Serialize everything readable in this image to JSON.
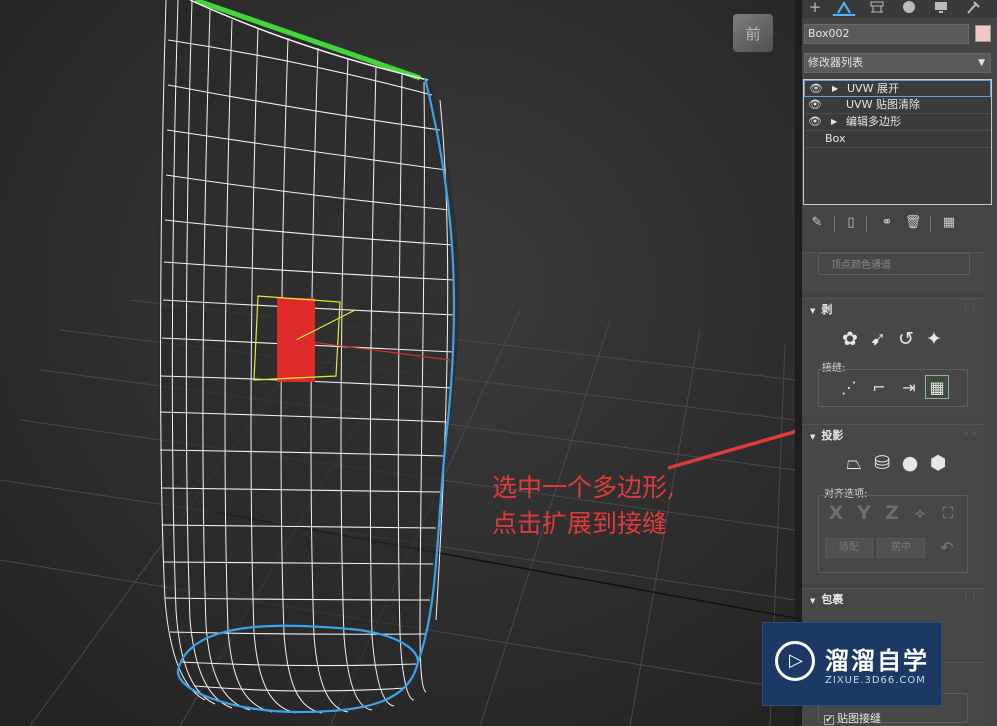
{
  "viewport": {
    "viewcube_label": "前",
    "annotation_lines": [
      "选中一个多边形,",
      "点击扩展到接缝"
    ],
    "colors": {
      "wireframe": "#f2f2f2",
      "seam": "#3aa2e8",
      "selection": "#e8e83a",
      "selected_poly": "#e02b2b",
      "edge_highlight": "#43d63a",
      "arrow": "#e03a3a"
    }
  },
  "command_panel": {
    "tabs": [
      "+",
      "modify-icon",
      "hierarchy-icon",
      "motion-icon",
      "display-icon",
      "utilities-icon"
    ],
    "object_name": "Box002",
    "object_color": "#f4c6c6",
    "modifier_list_label": "修改器列表",
    "stack": [
      {
        "label": "UVW 展开",
        "selected": true
      },
      {
        "label": "UVW 贴图清除",
        "selected": false
      },
      {
        "label": "编辑多边形",
        "selected": false
      },
      {
        "label": "Box",
        "selected": false
      }
    ],
    "partial_label": "顶点颜色通道",
    "rollouts": {
      "peel": {
        "title": "剥",
        "seams_label": "接缝:"
      },
      "projection": {
        "title": "投影",
        "align_label": "对齐选项:",
        "axes": [
          "X",
          "Y",
          "Z"
        ],
        "fit_label": "适配",
        "center_label": "居中"
      },
      "wrap": {
        "title": "包裹"
      },
      "map_seams": {
        "label": "贴图接缝",
        "checked": true
      }
    }
  },
  "watermark": {
    "title": "溜溜自学",
    "url": "ZIXUE.3D66.COM"
  }
}
